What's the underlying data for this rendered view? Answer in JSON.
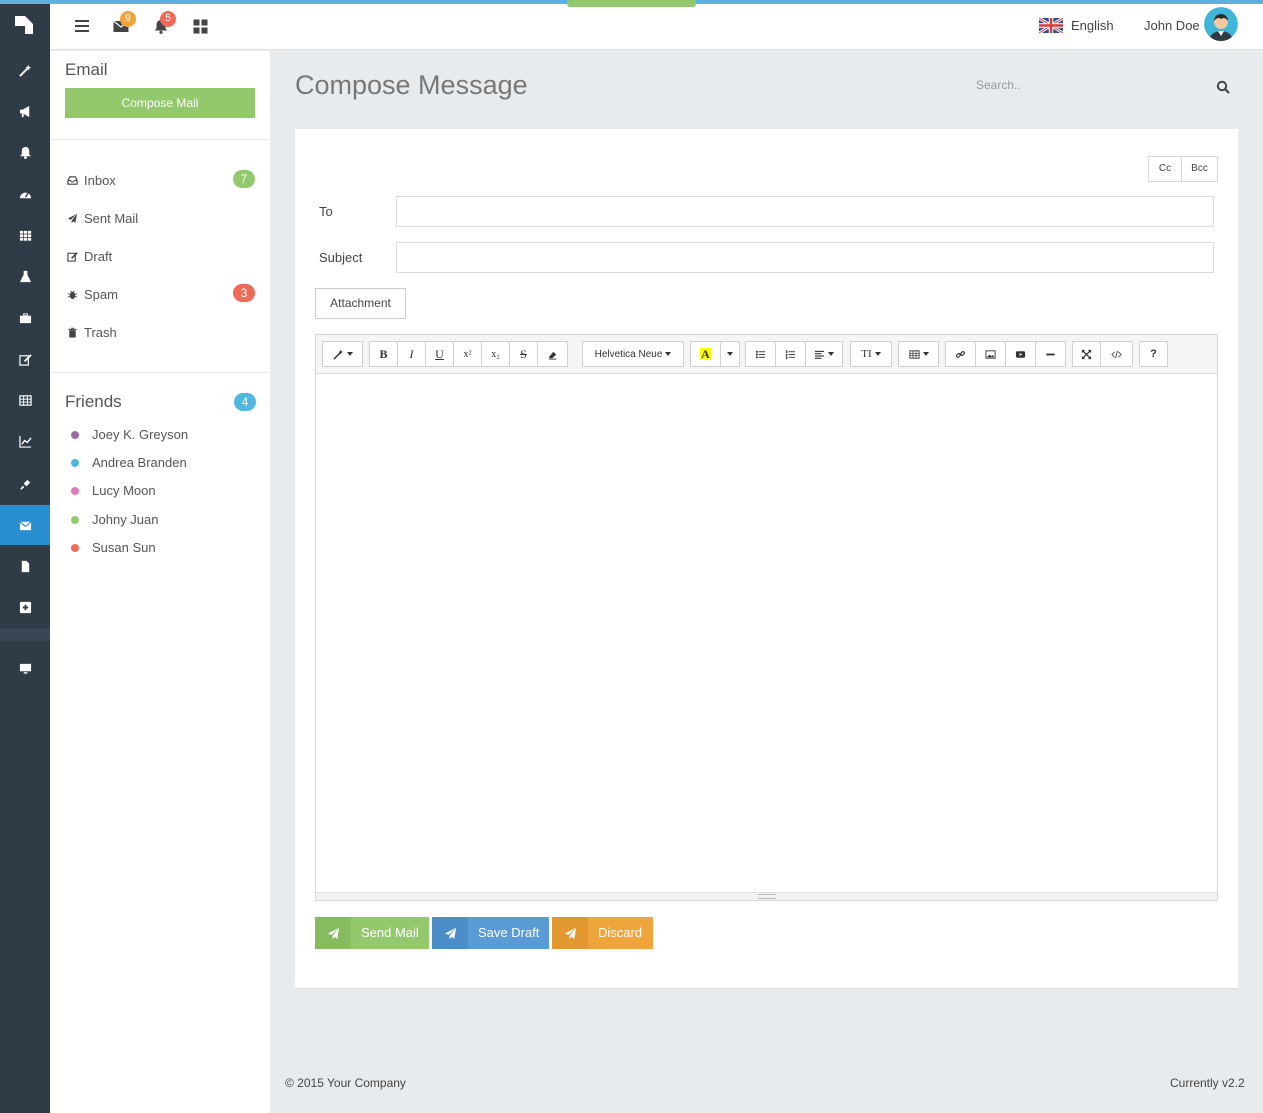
{
  "header": {
    "messages_badge": "9",
    "notifications_badge": "5",
    "language": "English",
    "user_name": "John Doe",
    "icons": [
      "menu-icon",
      "envelope-icon",
      "bell-icon",
      "grid-icon"
    ]
  },
  "rail": {
    "items": [
      "magic-icon",
      "bullhorn-icon",
      "bell-icon",
      "dashboard-icon",
      "th-icon",
      "flask-icon",
      "briefcase-icon",
      "edit-icon",
      "table-icon",
      "chart-icon",
      "plug-icon",
      "envelope-icon",
      "file-icon",
      "plus-square-icon",
      "desktop-icon"
    ],
    "active": "envelope-icon"
  },
  "sidebar": {
    "title": "Email",
    "compose_label": "Compose Mail",
    "folders": [
      {
        "label": "Inbox",
        "count": "7",
        "icon": "inbox-icon"
      },
      {
        "label": "Sent Mail",
        "count": "",
        "icon": "send-icon"
      },
      {
        "label": "Draft",
        "count": "",
        "icon": "edit-icon"
      },
      {
        "label": "Spam",
        "count": "3",
        "icon": "bug-icon"
      },
      {
        "label": "Trash",
        "count": "",
        "icon": "trash-icon"
      }
    ],
    "friends_title": "Friends",
    "friends_count": "4",
    "friends": [
      {
        "name": "Joey K. Greyson",
        "color": "#9b6aa3"
      },
      {
        "name": "Andrea Branden",
        "color": "#4fb8de"
      },
      {
        "name": "Lucy Moon",
        "color": "#e07cb5"
      },
      {
        "name": "Johny Juan",
        "color": "#93c86d"
      },
      {
        "name": "Susan Sun",
        "color": "#ef6a58"
      }
    ]
  },
  "main": {
    "title": "Compose Message",
    "search_placeholder": "Search..",
    "cc_label": "Cc",
    "bcc_label": "Bcc",
    "to_label": "To",
    "to_value": "",
    "subject_label": "Subject",
    "subject_value": "",
    "attachment_label": "Attachment",
    "font_name": "Helvetica Neue",
    "actions": {
      "send": "Send Mail",
      "save": "Save Draft",
      "discard": "Discard"
    }
  },
  "footer": {
    "copyright": "© 2015 Your Company",
    "version": "Currently v2.2"
  },
  "colors": {
    "green": "#93c86d",
    "blue": "#5a9bd5",
    "orange": "#f0a53c",
    "red": "#ef6a58",
    "sidebar_dark": "#2f3b47",
    "active_blue": "#2a8fd0"
  }
}
